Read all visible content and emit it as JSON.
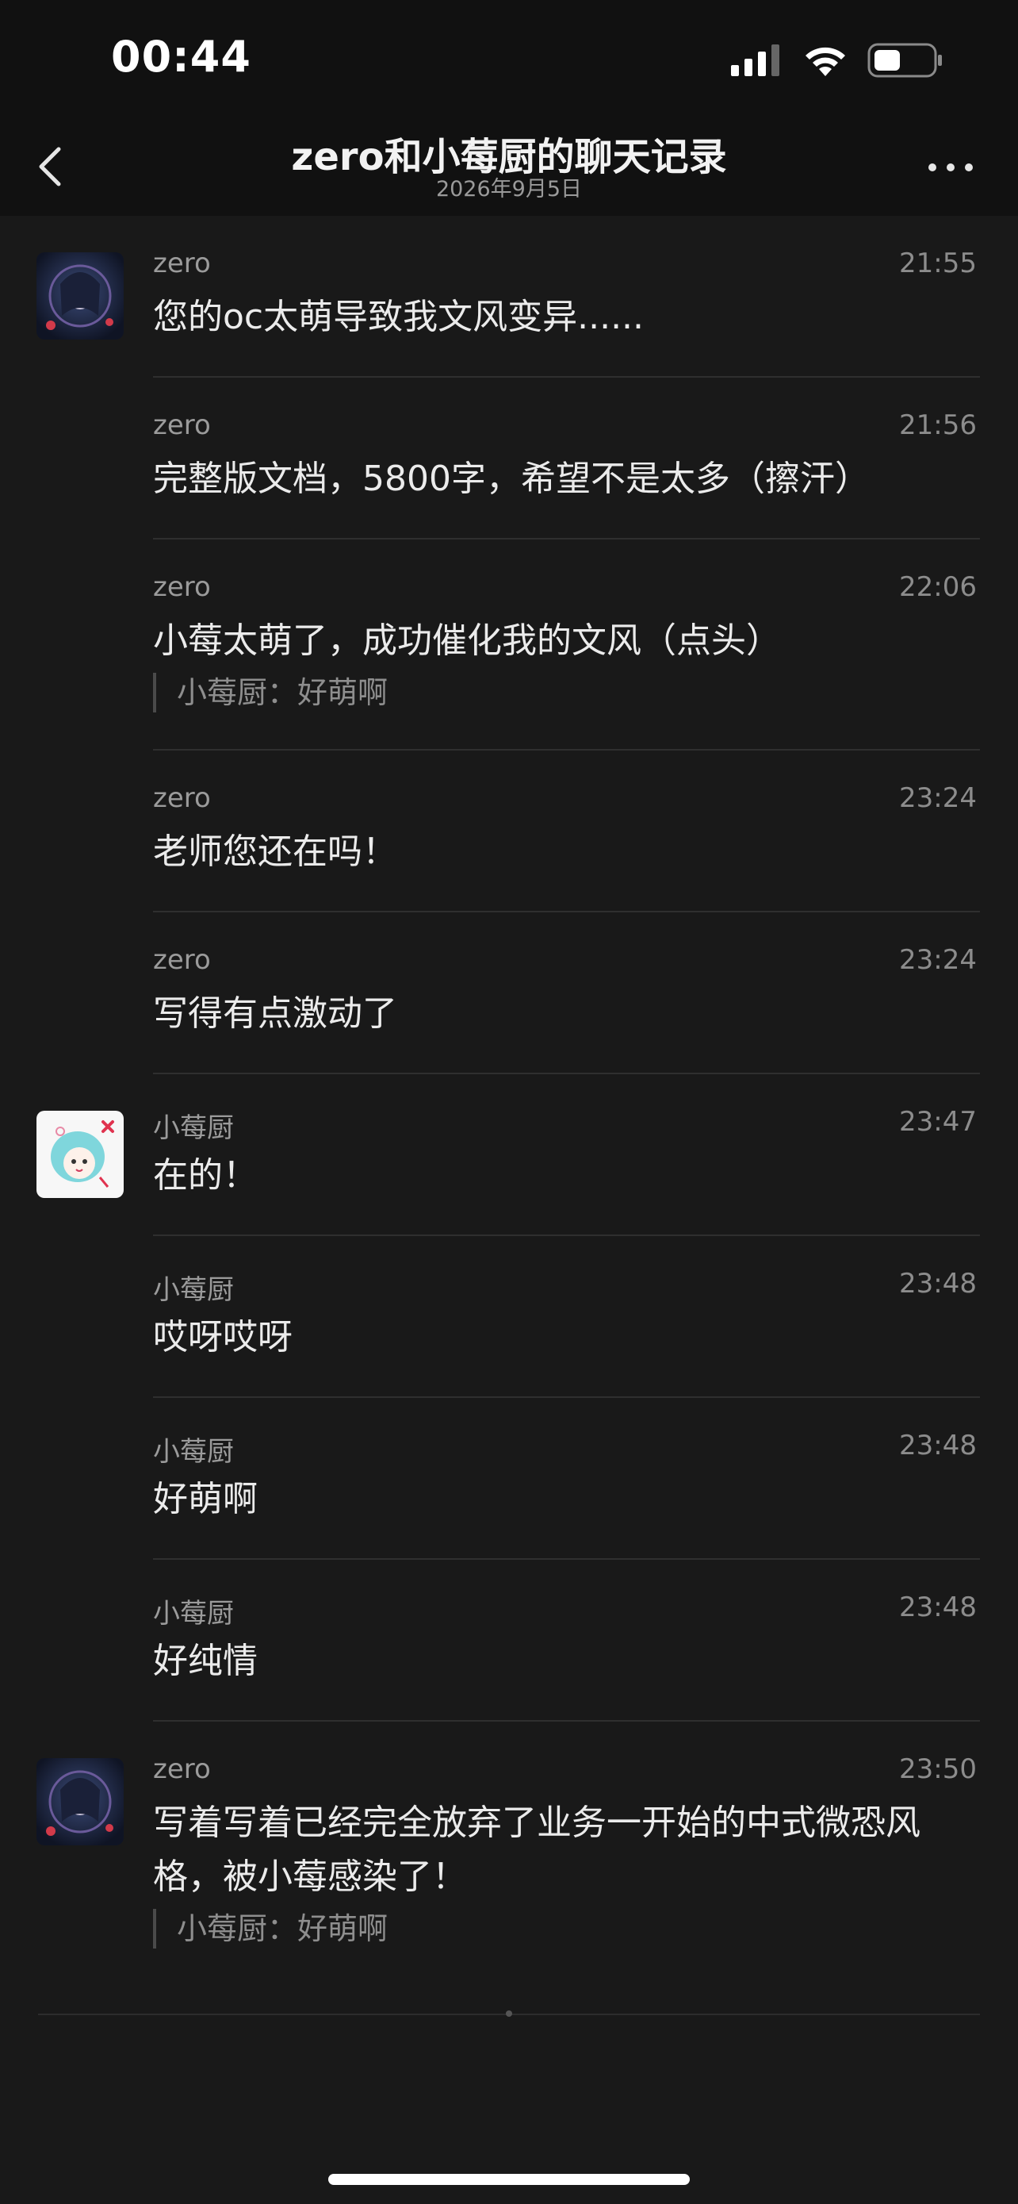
{
  "status_bar": {
    "time": "00:44"
  },
  "nav": {
    "title": "zero和小莓厨的聊天记录",
    "subtitle": "2026年9月5日"
  },
  "messages": [
    {
      "sender": "zero",
      "time": "21:55",
      "text": "您的oc太萌导致我文风变异......",
      "avatar": "avatar-zero"
    },
    {
      "sender": "zero",
      "time": "21:56",
      "text": "完整版文档，5800字，希望不是太多（擦汗）"
    },
    {
      "sender": "zero",
      "time": "22:06",
      "text": "小莓太萌了，成功催化我的文风（点头）",
      "quote": "小莓厨：好萌啊"
    },
    {
      "sender": "zero",
      "time": "23:24",
      "text": "老师您还在吗！"
    },
    {
      "sender": "zero",
      "time": "23:24",
      "text": "写得有点激动了"
    },
    {
      "sender": "小莓厨",
      "time": "23:47",
      "text": "在的！",
      "avatar": "avatar-xiaomeichu"
    },
    {
      "sender": "小莓厨",
      "time": "23:48",
      "text": "哎呀哎呀"
    },
    {
      "sender": "小莓厨",
      "time": "23:48",
      "text": "好萌啊"
    },
    {
      "sender": "小莓厨",
      "time": "23:48",
      "text": "好纯情"
    },
    {
      "sender": "zero",
      "time": "23:50",
      "text": "写着写着已经完全放弃了业务一开始的中式微恐风格，被小莓感染了！",
      "quote": "小莓厨：好萌啊",
      "avatar": "avatar-zero"
    }
  ]
}
